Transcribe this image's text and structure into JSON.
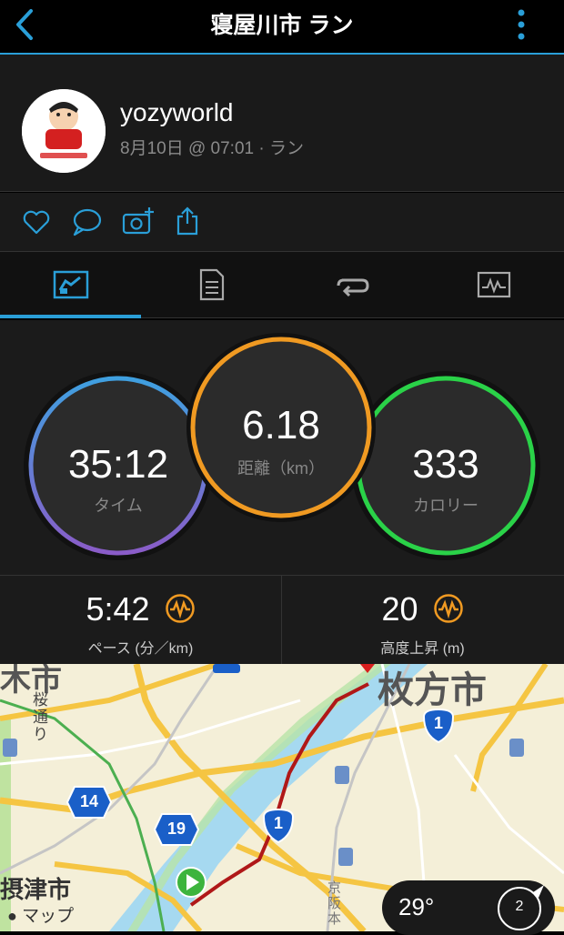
{
  "header": {
    "title": "寝屋川市 ラン"
  },
  "profile": {
    "username": "yozyworld",
    "meta": "8月10日 @ 07:01 · ラン"
  },
  "stats": {
    "time": {
      "value": "35:12",
      "label": "タイム",
      "ring_colors": [
        "#3fa0e0",
        "#8a5cc8"
      ]
    },
    "distance": {
      "value": "6.18",
      "label": "距離（km）",
      "ring_color": "#f09a22"
    },
    "calories": {
      "value": "333",
      "label": "カロリー",
      "ring_color": "#2ad248"
    }
  },
  "metrics": [
    {
      "value": "5:42",
      "label": "ペース (分／km)"
    },
    {
      "value": "20",
      "label": "高度上昇 (m)"
    }
  ],
  "map": {
    "labels": {
      "city_hirakata": "枚方市",
      "city_settsu": "摂津市",
      "sakura_dori": "桜通り",
      "keihan": "京阪本",
      "apple_maps": "マップ",
      "partial_city": "木市"
    },
    "route_badges": [
      "1",
      "14",
      "19",
      "1"
    ]
  },
  "weather": {
    "temp": "29°",
    "wind": "2"
  },
  "colors": {
    "accent": "#2a9fd8",
    "orange": "#f09a22",
    "route": "#b01818"
  }
}
